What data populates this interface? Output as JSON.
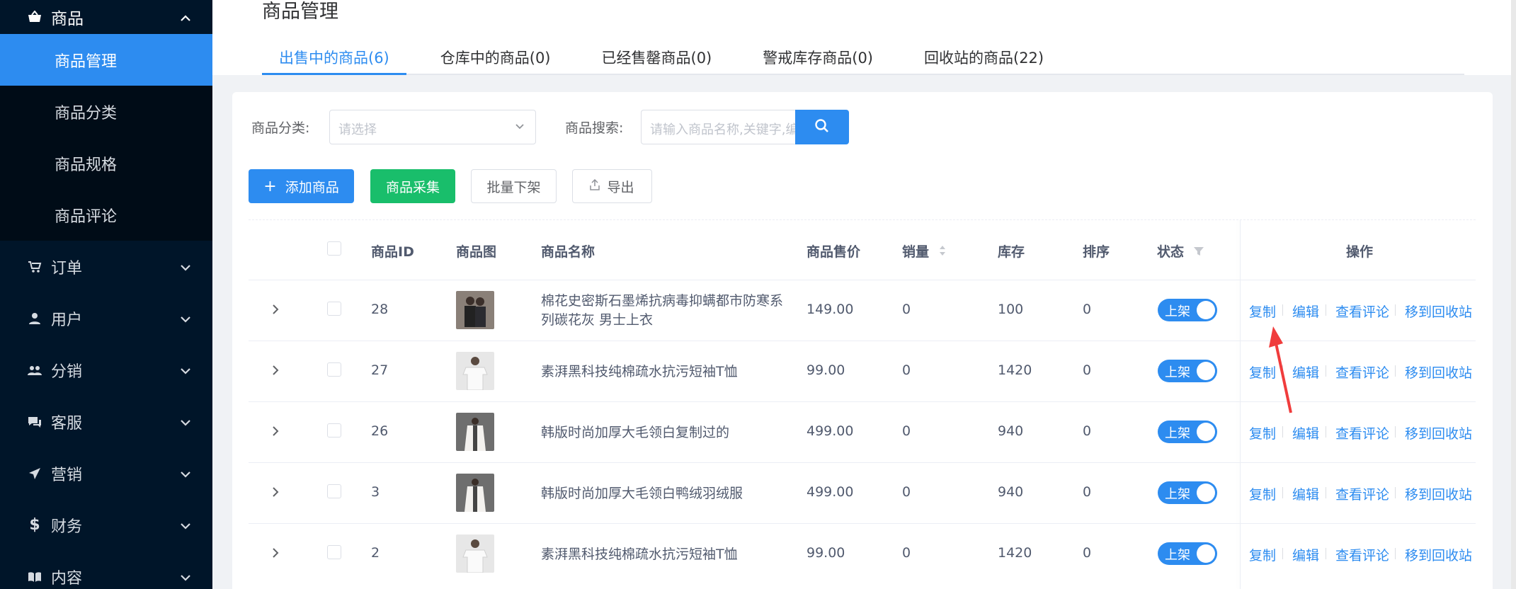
{
  "sidebar": {
    "head": {
      "label": "商品",
      "icon": "basket-icon"
    },
    "sub_items": [
      {
        "label": "商品管理",
        "active": true
      },
      {
        "label": "商品分类",
        "active": false
      },
      {
        "label": "商品规格",
        "active": false
      },
      {
        "label": "商品评论",
        "active": false
      }
    ],
    "items": [
      {
        "label": "订单",
        "icon": "cart-icon"
      },
      {
        "label": "用户",
        "icon": "user-icon"
      },
      {
        "label": "分销",
        "icon": "group-icon"
      },
      {
        "label": "客服",
        "icon": "chat-icon"
      },
      {
        "label": "营销",
        "icon": "send-icon"
      },
      {
        "label": "财务",
        "icon": "dollar-icon"
      },
      {
        "label": "内容",
        "icon": "book-icon"
      }
    ]
  },
  "page": {
    "title": "商品管理"
  },
  "tabs": [
    {
      "label": "出售中的商品(6)",
      "active": true
    },
    {
      "label": "仓库中的商品(0)",
      "active": false
    },
    {
      "label": "已经售罄商品(0)",
      "active": false
    },
    {
      "label": "警戒库存商品(0)",
      "active": false
    },
    {
      "label": "回收站的商品(22)",
      "active": false
    }
  ],
  "filters": {
    "category_label": "商品分类:",
    "category_placeholder": "请选择",
    "search_label": "商品搜索:",
    "search_placeholder": "请输入商品名称,关键字,编号"
  },
  "toolbar": {
    "add_label": "添加商品",
    "collect_label": "商品采集",
    "batch_off_label": "批量下架",
    "export_label": "导出"
  },
  "table": {
    "headers": {
      "id": "商品ID",
      "image": "商品图",
      "name": "商品名称",
      "price": "商品售价",
      "sales": "销量",
      "stock": "库存",
      "sort": "排序",
      "status": "状态",
      "actions": "操作"
    },
    "rows": [
      {
        "id": "28",
        "name": "棉花史密斯石墨烯抗病毒抑螨都市防寒系列碳花灰 男士上衣",
        "price": "149.00",
        "sales": "0",
        "stock": "100",
        "sort": "0",
        "status": "上架",
        "thumb": "dark"
      },
      {
        "id": "27",
        "name": "素湃黑科技纯棉疏水抗污短袖T恤",
        "price": "99.00",
        "sales": "0",
        "stock": "1420",
        "sort": "0",
        "status": "上架",
        "thumb": "light"
      },
      {
        "id": "26",
        "name": "韩版时尚加厚大毛领白复制过的",
        "price": "499.00",
        "sales": "0",
        "stock": "940",
        "sort": "0",
        "status": "上架",
        "thumb": "coat"
      },
      {
        "id": "3",
        "name": "韩版时尚加厚大毛领白鸭绒羽绒服",
        "price": "499.00",
        "sales": "0",
        "stock": "940",
        "sort": "0",
        "status": "上架",
        "thumb": "coat"
      },
      {
        "id": "2",
        "name": "素湃黑科技纯棉疏水抗污短袖T恤",
        "price": "99.00",
        "sales": "0",
        "stock": "1420",
        "sort": "0",
        "status": "上架",
        "thumb": "light"
      }
    ],
    "actions": [
      "复制",
      "编辑",
      "查看评论",
      "移到回收站"
    ]
  },
  "colors": {
    "primary": "#2d8cf0",
    "success": "#19be6b",
    "sidebar": "#001529",
    "annotation_arrow": "#f03c3c"
  }
}
